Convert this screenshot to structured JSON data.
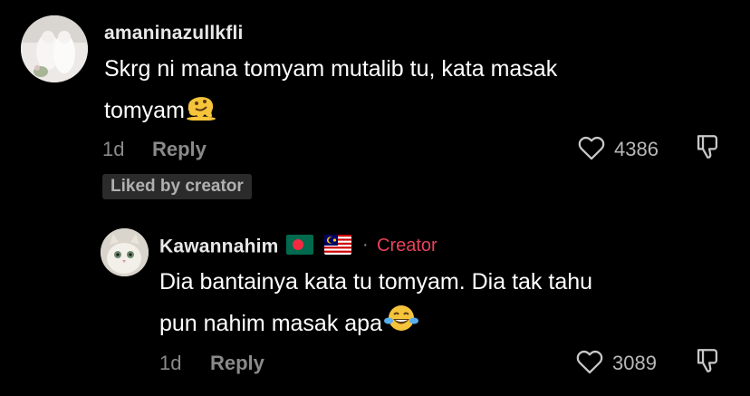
{
  "comments": [
    {
      "username": "amaninazullkfli",
      "text_line1": "Skrg ni mana tomyam mutalib tu, kata masak",
      "text_line2": "tomyam",
      "emoji": "melting-face",
      "time": "1d",
      "reply_label": "Reply",
      "likes": "4386",
      "liked_by_creator_label": "Liked by creator"
    },
    {
      "username": "Kawannahim",
      "flags": [
        "bangladesh-flag",
        "malaysia-flag"
      ],
      "separator": "·",
      "creator_label": "Creator",
      "text_line1": "Dia bantainya kata tu tomyam. Dia tak tahu",
      "text_line2": "pun nahim masak apa",
      "emoji": "face-with-tears-of-joy",
      "time": "1d",
      "reply_label": "Reply",
      "likes": "3089"
    }
  ],
  "colors": {
    "background": "#000000",
    "creator": "#e8425a",
    "muted": "#8a8a8a"
  }
}
